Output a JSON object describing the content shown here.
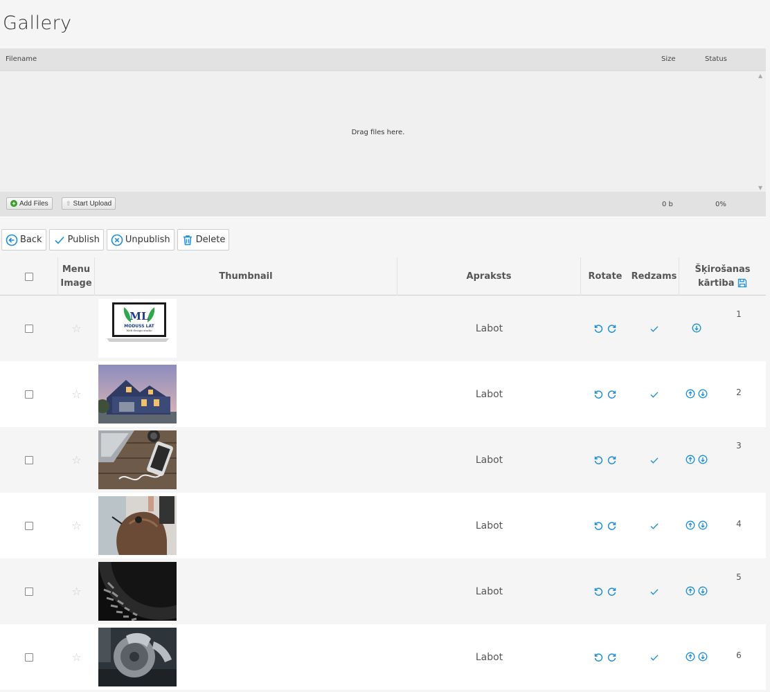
{
  "page": {
    "title": "Gallery"
  },
  "uploader": {
    "col_filename": "Filename",
    "col_size": "Size",
    "col_status": "Status",
    "drop_text": "Drag files here.",
    "add_files": "Add Files",
    "start_upload": "Start Upload",
    "total_size": "0 b",
    "total_percent": "0%"
  },
  "toolbar": {
    "back": "Back",
    "publish": "Publish",
    "unpublish": "Unpublish",
    "delete": "Delete"
  },
  "table": {
    "headers": {
      "menu_image_1": "Menu",
      "menu_image_2": "Image",
      "thumbnail": "Thumbnail",
      "apraksts": "Apraksts",
      "rotate": "Rotate",
      "redzams": "Redzams",
      "order_1": "Šķirošanas",
      "order_2": "kārtiba"
    },
    "rows": [
      {
        "thumbnail": "moduss-lat-logo",
        "logo_top": "ML",
        "logo_name": "MODUSS LAT",
        "logo_sub": "Web design studio",
        "apraksts": "Labot",
        "order": "1",
        "published": true
      },
      {
        "thumbnail": "house-photo",
        "apraksts": "Labot",
        "order": "2",
        "published": true
      },
      {
        "thumbnail": "laptop-phone-photo",
        "apraksts": "Labot",
        "order": "3",
        "published": true
      },
      {
        "thumbnail": "hair-styling-photo",
        "apraksts": "Labot",
        "order": "4",
        "published": true
      },
      {
        "thumbnail": "tire-photo",
        "apraksts": "Labot",
        "order": "5",
        "published": true
      },
      {
        "thumbnail": "brake-repair-photo",
        "apraksts": "Labot",
        "order": "6",
        "published": true
      }
    ]
  },
  "colors": {
    "accent": "#1a8fd8",
    "header_bg": "#e2e2e2",
    "add_green": "#3d9a2f"
  }
}
